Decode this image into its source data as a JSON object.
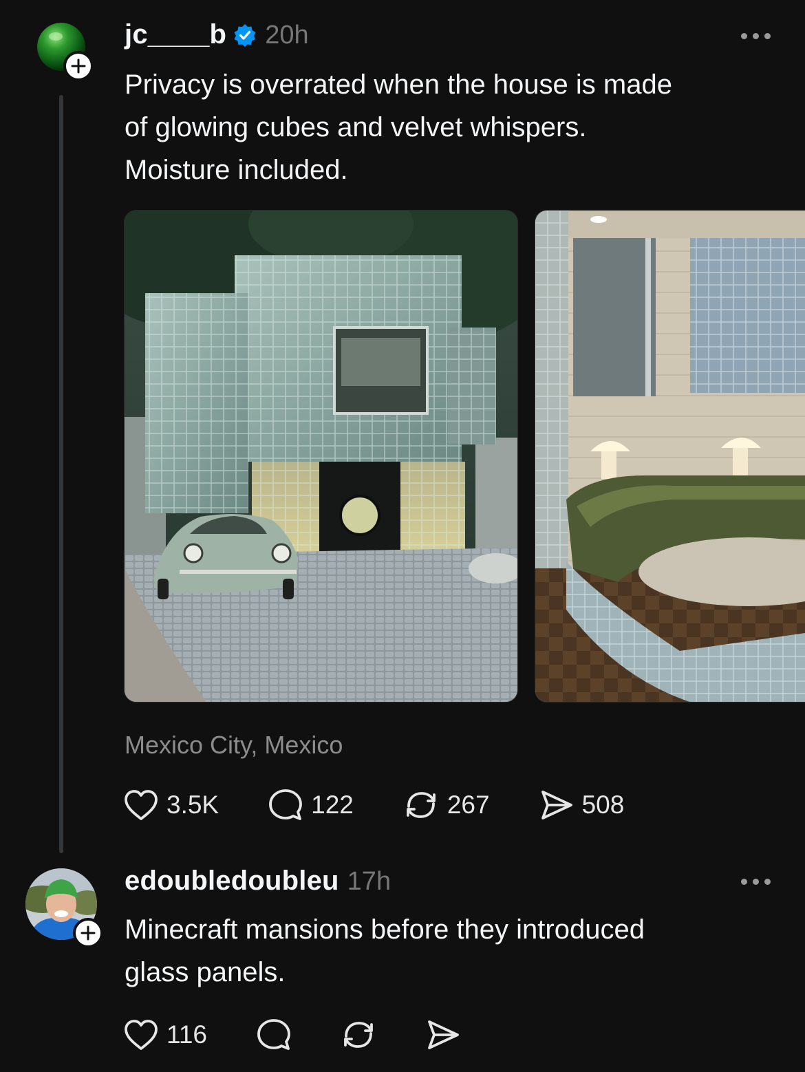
{
  "post": {
    "username": "jc____b",
    "verified": true,
    "time": "20h",
    "text_lines": [
      "Privacy is overrated when the house is made",
      "of glowing cubes and velvet whispers.",
      "Moisture included."
    ],
    "location": "Mexico City, Mexico",
    "stats": {
      "likes": "3.5K",
      "replies": "122",
      "reposts": "267",
      "shares": "508"
    }
  },
  "reply": {
    "username": "edoubledoubleu",
    "time": "17h",
    "text_lines": [
      "Minecraft mansions before they introduced",
      "glass panels."
    ],
    "stats": {
      "likes": "116"
    }
  },
  "icons": {
    "verified": "verified-badge-icon",
    "more": "more-dots-icon",
    "like": "heart-icon",
    "reply": "comment-bubble-icon",
    "repost": "repost-icon",
    "share": "send-icon",
    "follow": "plus-icon"
  },
  "colors": {
    "background": "#101010",
    "verified": "#0095f6",
    "secondary_text": "#777777"
  }
}
